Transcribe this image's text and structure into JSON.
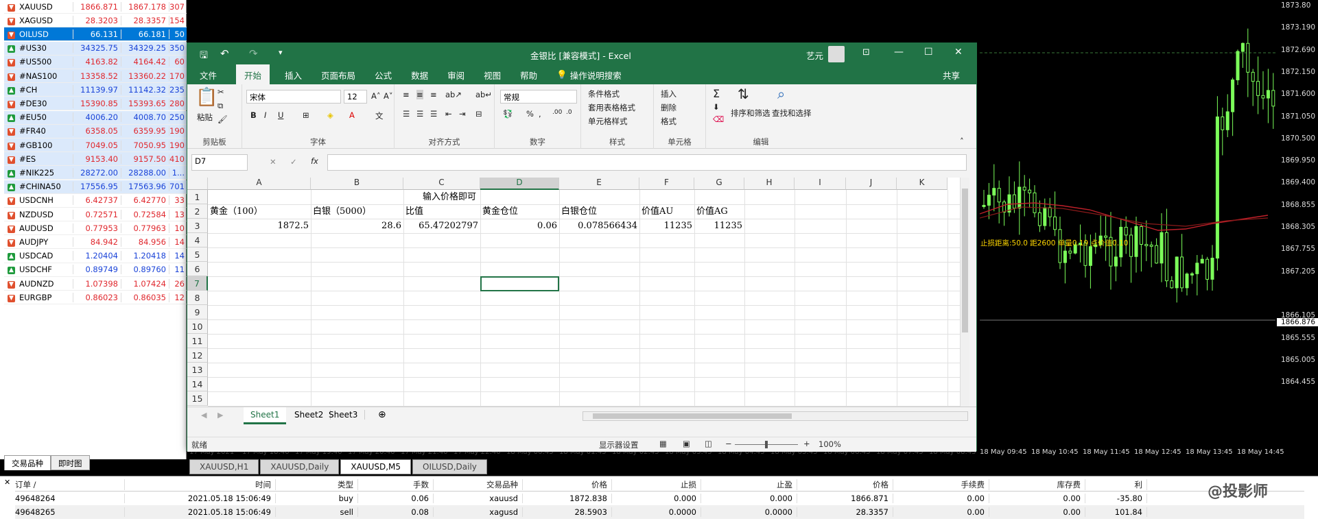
{
  "market_watch": {
    "rows": [
      {
        "symbol": "XAUUSD",
        "bid": "1866.871",
        "ask": "1867.178",
        "spread": "307",
        "dir": "down",
        "style": "normal"
      },
      {
        "symbol": "XAGUSD",
        "bid": "28.3203",
        "ask": "28.3357",
        "spread": "154",
        "dir": "down",
        "style": "normal"
      },
      {
        "symbol": "OILUSD",
        "bid": "66.131",
        "ask": "66.181",
        "spread": "50",
        "dir": "down",
        "style": "sel"
      },
      {
        "symbol": "#US30",
        "bid": "34325.75",
        "ask": "34329.25",
        "spread": "350",
        "dir": "up",
        "style": "blue"
      },
      {
        "symbol": "#US500",
        "bid": "4163.82",
        "ask": "4164.42",
        "spread": "60",
        "dir": "down",
        "style": "blue"
      },
      {
        "symbol": "#NAS100",
        "bid": "13358.52",
        "ask": "13360.22",
        "spread": "170",
        "dir": "down",
        "style": "blue"
      },
      {
        "symbol": "#CH",
        "bid": "11139.97",
        "ask": "11142.32",
        "spread": "235",
        "dir": "up",
        "style": "blue"
      },
      {
        "symbol": "#DE30",
        "bid": "15390.85",
        "ask": "15393.65",
        "spread": "280",
        "dir": "down",
        "style": "blue"
      },
      {
        "symbol": "#EU50",
        "bid": "4006.20",
        "ask": "4008.70",
        "spread": "250",
        "dir": "up",
        "style": "blue"
      },
      {
        "symbol": "#FR40",
        "bid": "6358.05",
        "ask": "6359.95",
        "spread": "190",
        "dir": "down",
        "style": "blue"
      },
      {
        "symbol": "#GB100",
        "bid": "7049.05",
        "ask": "7050.95",
        "spread": "190",
        "dir": "down",
        "style": "blue"
      },
      {
        "symbol": "#ES",
        "bid": "9153.40",
        "ask": "9157.50",
        "spread": "410",
        "dir": "down",
        "style": "blue"
      },
      {
        "symbol": "#NIK225",
        "bid": "28272.00",
        "ask": "28288.00",
        "spread": "1...",
        "dir": "up",
        "style": "blue"
      },
      {
        "symbol": "#CHINA50",
        "bid": "17556.95",
        "ask": "17563.96",
        "spread": "701",
        "dir": "up",
        "style": "blue"
      },
      {
        "symbol": "USDCNH",
        "bid": "6.42737",
        "ask": "6.42770",
        "spread": "33",
        "dir": "down",
        "style": "normal"
      },
      {
        "symbol": "NZDUSD",
        "bid": "0.72571",
        "ask": "0.72584",
        "spread": "13",
        "dir": "down",
        "style": "normal"
      },
      {
        "symbol": "AUDUSD",
        "bid": "0.77953",
        "ask": "0.77963",
        "spread": "10",
        "dir": "down",
        "style": "normal"
      },
      {
        "symbol": "AUDJPY",
        "bid": "84.942",
        "ask": "84.956",
        "spread": "14",
        "dir": "down",
        "style": "normal"
      },
      {
        "symbol": "USDCAD",
        "bid": "1.20404",
        "ask": "1.20418",
        "spread": "14",
        "dir": "up",
        "style": "normal"
      },
      {
        "symbol": "USDCHF",
        "bid": "0.89749",
        "ask": "0.89760",
        "spread": "11",
        "dir": "up",
        "style": "normal"
      },
      {
        "symbol": "AUDNZD",
        "bid": "1.07398",
        "ask": "1.07424",
        "spread": "26",
        "dir": "down",
        "style": "normal"
      },
      {
        "symbol": "EURGBP",
        "bid": "0.86023",
        "ask": "0.86035",
        "spread": "12",
        "dir": "down",
        "style": "normal"
      }
    ],
    "tabs": [
      "交易品种",
      "即时图"
    ]
  },
  "chart": {
    "prices": [
      "1873.80",
      "1873.190",
      "1872.690",
      "1872.150",
      "1871.600",
      "1871.050",
      "1870.500",
      "1869.950",
      "1869.400",
      "1868.855",
      "1868.305",
      "1867.755",
      "1867.205",
      "1866.876",
      "1866.105",
      "1865.555",
      "1865.005",
      "1864.455"
    ],
    "current_price": "1866.876",
    "times": [
      "17 May 2021",
      "17 May 18:40",
      "17 May 19:40",
      "17 May 20:40",
      "17 May 21:40",
      "17 May 22:40",
      "18 May 00:45",
      "18 May 01:45",
      "18 May 02:45",
      "18 May 03:45",
      "18 May 04:45",
      "18 May 05:45",
      "18 May 06:45",
      "18 May 07:45",
      "18 May 08:45",
      "18 May 09:45",
      "18 May 10:45",
      "18 May 11:45",
      "18 May 12:45",
      "18 May 13:45",
      "18 May 14:45"
    ],
    "annotation": "止损距离:50.0 距2600 单量0.19 点价值0.10",
    "tabs": [
      "XAUUSD,H1",
      "XAUUSD,Daily",
      "XAUUSD,M5",
      "OILUSD,Daily"
    ],
    "active_tab": "XAUUSD,M5",
    "candle_color": "#7cff5a"
  },
  "terminal": {
    "headers": [
      "订单 /",
      "时间",
      "类型",
      "手数",
      "交易品种",
      "价格",
      "止损",
      "止盈",
      "价格",
      "手续费",
      "库存费",
      "利"
    ],
    "rows": [
      [
        "49648264",
        "2021.05.18 15:06:49",
        "buy",
        "0.06",
        "xauusd",
        "1872.838",
        "0.000",
        "0.000",
        "1866.871",
        "0.00",
        "0.00",
        "-35.80"
      ],
      [
        "49648265",
        "2021.05.18 15:06:49",
        "sell",
        "0.08",
        "xagusd",
        "28.5903",
        "0.0000",
        "0.0000",
        "28.3357",
        "0.00",
        "0.00",
        "101.84"
      ]
    ],
    "watermark": "@投影师"
  },
  "excel": {
    "title": "金银比  [兼容模式]  -  Excel",
    "user": "艺元",
    "menu": [
      "文件",
      "开始",
      "插入",
      "页面布局",
      "公式",
      "数据",
      "审阅",
      "视图",
      "帮助",
      "操作说明搜索"
    ],
    "share": "共享",
    "ribbon": {
      "paste": "粘贴",
      "clipboard": "剪贴板",
      "font_name": "宋体",
      "font_size": "12",
      "font": "字体",
      "alignment": "对齐方式",
      "number_format": "常规",
      "number": "数字",
      "cond_format": "条件格式",
      "table_format": "套用表格格式",
      "cell_style": "单元格样式",
      "styles": "样式",
      "insert": "插入",
      "delete": "删除",
      "format": "格式",
      "cells": "单元格",
      "sort_filter": "排序和筛选",
      "find_select": "查找和选择",
      "editing": "编辑"
    },
    "name_box": "D7",
    "columns": [
      "A",
      "B",
      "C",
      "D",
      "E",
      "F",
      "G",
      "H",
      "I",
      "J",
      "K"
    ],
    "rows": [
      "1",
      "2",
      "3",
      "4",
      "5",
      "6",
      "7",
      "8",
      "9",
      "10",
      "11",
      "12",
      "13",
      "14",
      "15"
    ],
    "r1": "输入价格即可",
    "r2": [
      "黄金（100）",
      "白银（5000）",
      "比值",
      "黄金仓位",
      "白银仓位",
      "价值AU",
      "价值AG"
    ],
    "r3": [
      "1872.5",
      "28.6",
      "65.47202797",
      "0.06",
      "0.078566434",
      "11235",
      "11235"
    ],
    "sheets": [
      "Sheet1",
      "Sheet2",
      "Sheet3"
    ],
    "status": "就绪",
    "display_settings": "显示器设置",
    "zoom": "100%"
  }
}
